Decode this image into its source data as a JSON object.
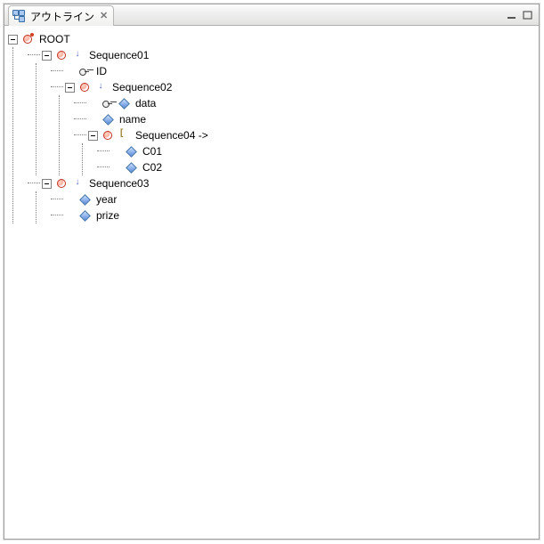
{
  "tab": {
    "title": "アウトライン"
  },
  "tree": {
    "root": {
      "label": "ROOT",
      "children": {
        "seq01": {
          "label": "Sequence01",
          "children": {
            "id": {
              "label": "ID"
            },
            "seq02": {
              "label": "Sequence02",
              "children": {
                "data": {
                  "label": "data"
                },
                "name": {
                  "label": "name"
                },
                "seq04": {
                  "label": "Sequence04 ->",
                  "children": {
                    "c01": {
                      "label": "C01"
                    },
                    "c02": {
                      "label": "C02"
                    }
                  }
                }
              }
            }
          }
        },
        "seq03": {
          "label": "Sequence03",
          "children": {
            "year": {
              "label": "year"
            },
            "prize": {
              "label": "prize"
            }
          }
        }
      }
    }
  }
}
